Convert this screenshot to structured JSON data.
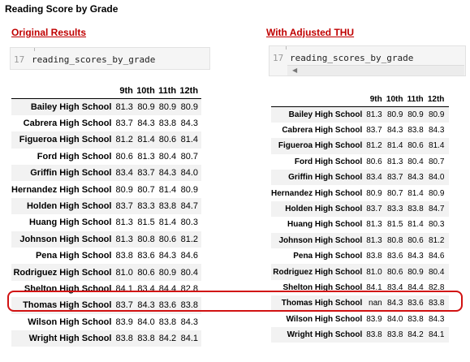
{
  "page_title": "Reading Score by Grade",
  "left": {
    "heading": "Original Results",
    "cell_number": "17",
    "cell_code": "reading_scores_by_grade",
    "columns": [
      "9th",
      "10th",
      "11th",
      "12th"
    ],
    "rows": [
      {
        "school": "Bailey High School",
        "values": [
          "81.3",
          "80.9",
          "80.9",
          "80.9"
        ]
      },
      {
        "school": "Cabrera High School",
        "values": [
          "83.7",
          "84.3",
          "83.8",
          "84.3"
        ]
      },
      {
        "school": "Figueroa High School",
        "values": [
          "81.2",
          "81.4",
          "80.6",
          "81.4"
        ]
      },
      {
        "school": "Ford High School",
        "values": [
          "80.6",
          "81.3",
          "80.4",
          "80.7"
        ]
      },
      {
        "school": "Griffin High School",
        "values": [
          "83.4",
          "83.7",
          "84.3",
          "84.0"
        ]
      },
      {
        "school": "Hernandez High School",
        "values": [
          "80.9",
          "80.7",
          "81.4",
          "80.9"
        ]
      },
      {
        "school": "Holden High School",
        "values": [
          "83.7",
          "83.3",
          "83.8",
          "84.7"
        ]
      },
      {
        "school": "Huang High School",
        "values": [
          "81.3",
          "81.5",
          "81.4",
          "80.3"
        ]
      },
      {
        "school": "Johnson High School",
        "values": [
          "81.3",
          "80.8",
          "80.6",
          "81.2"
        ]
      },
      {
        "school": "Pena High School",
        "values": [
          "83.8",
          "83.6",
          "84.3",
          "84.6"
        ]
      },
      {
        "school": "Rodriguez High School",
        "values": [
          "81.0",
          "80.6",
          "80.9",
          "80.4"
        ]
      },
      {
        "school": "Shelton High School",
        "values": [
          "84.1",
          "83.4",
          "84.4",
          "82.8"
        ]
      },
      {
        "school": "Thomas High School",
        "values": [
          "83.7",
          "84.3",
          "83.6",
          "83.8"
        ]
      },
      {
        "school": "Wilson High School",
        "values": [
          "83.9",
          "84.0",
          "83.8",
          "84.3"
        ]
      },
      {
        "school": "Wright High School",
        "values": [
          "83.8",
          "83.8",
          "84.2",
          "84.1"
        ]
      }
    ]
  },
  "right": {
    "heading": "With Adjusted THU",
    "cell_number": "17",
    "cell_code": "reading_scores_by_grade",
    "columns": [
      "9th",
      "10th",
      "11th",
      "12th"
    ],
    "rows": [
      {
        "school": "Bailey High School",
        "values": [
          "81.3",
          "80.9",
          "80.9",
          "80.9"
        ]
      },
      {
        "school": "Cabrera High School",
        "values": [
          "83.7",
          "84.3",
          "83.8",
          "84.3"
        ]
      },
      {
        "school": "Figueroa High School",
        "values": [
          "81.2",
          "81.4",
          "80.6",
          "81.4"
        ]
      },
      {
        "school": "Ford High School",
        "values": [
          "80.6",
          "81.3",
          "80.4",
          "80.7"
        ]
      },
      {
        "school": "Griffin High School",
        "values": [
          "83.4",
          "83.7",
          "84.3",
          "84.0"
        ]
      },
      {
        "school": "Hernandez High School",
        "values": [
          "80.9",
          "80.7",
          "81.4",
          "80.9"
        ]
      },
      {
        "school": "Holden High School",
        "values": [
          "83.7",
          "83.3",
          "83.8",
          "84.7"
        ]
      },
      {
        "school": "Huang High School",
        "values": [
          "81.3",
          "81.5",
          "81.4",
          "80.3"
        ]
      },
      {
        "school": "Johnson High School",
        "values": [
          "81.3",
          "80.8",
          "80.6",
          "81.2"
        ]
      },
      {
        "school": "Pena High School",
        "values": [
          "83.8",
          "83.6",
          "84.3",
          "84.6"
        ]
      },
      {
        "school": "Rodriguez High School",
        "values": [
          "81.0",
          "80.6",
          "80.9",
          "80.4"
        ]
      },
      {
        "school": "Shelton High School",
        "values": [
          "84.1",
          "83.4",
          "84.4",
          "82.8"
        ]
      },
      {
        "school": "Thomas High School",
        "values": [
          "nan",
          "84.3",
          "83.6",
          "83.8"
        ]
      },
      {
        "school": "Wilson High School",
        "values": [
          "83.9",
          "84.0",
          "83.8",
          "84.3"
        ]
      },
      {
        "school": "Wright High School",
        "values": [
          "83.8",
          "83.8",
          "84.2",
          "84.1"
        ]
      }
    ]
  },
  "highlight_color": "#d11212",
  "heading_color": "#c00000"
}
